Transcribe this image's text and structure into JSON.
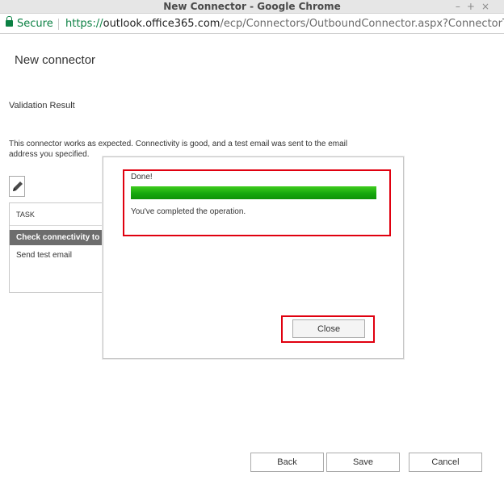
{
  "window": {
    "title": "New Connector - Google Chrome",
    "controls": {
      "minimize": "–",
      "maximize": "+",
      "close": "×"
    }
  },
  "address_bar": {
    "secure_label": "Secure",
    "url_scheme": "https://",
    "url_host": "outlook.office365.com",
    "url_path": "/ecp/Connectors/OutboundConnector.aspx?ConnectorTyp..."
  },
  "page": {
    "title": "New connector",
    "section_heading": "Validation Result",
    "description": "This connector works as expected. Connectivity is good, and a test email was sent to the email address you specified."
  },
  "task_table": {
    "column_header": "TASK",
    "rows": [
      "Check connectivity to",
      "Send test email"
    ]
  },
  "dialog": {
    "status_label": "Done!",
    "progress_percent": 100,
    "message": "You've completed the operation.",
    "close_label": "Close"
  },
  "footer": {
    "back_label": "Back",
    "save_label": "Save",
    "cancel_label": "Cancel"
  },
  "colors": {
    "secure_green": "#0b8043",
    "highlight_red": "#e0000f",
    "progress_green": "#16a80d",
    "selected_row": "#6d6d6d"
  },
  "icons": [
    "lock-icon",
    "pencil-icon"
  ]
}
